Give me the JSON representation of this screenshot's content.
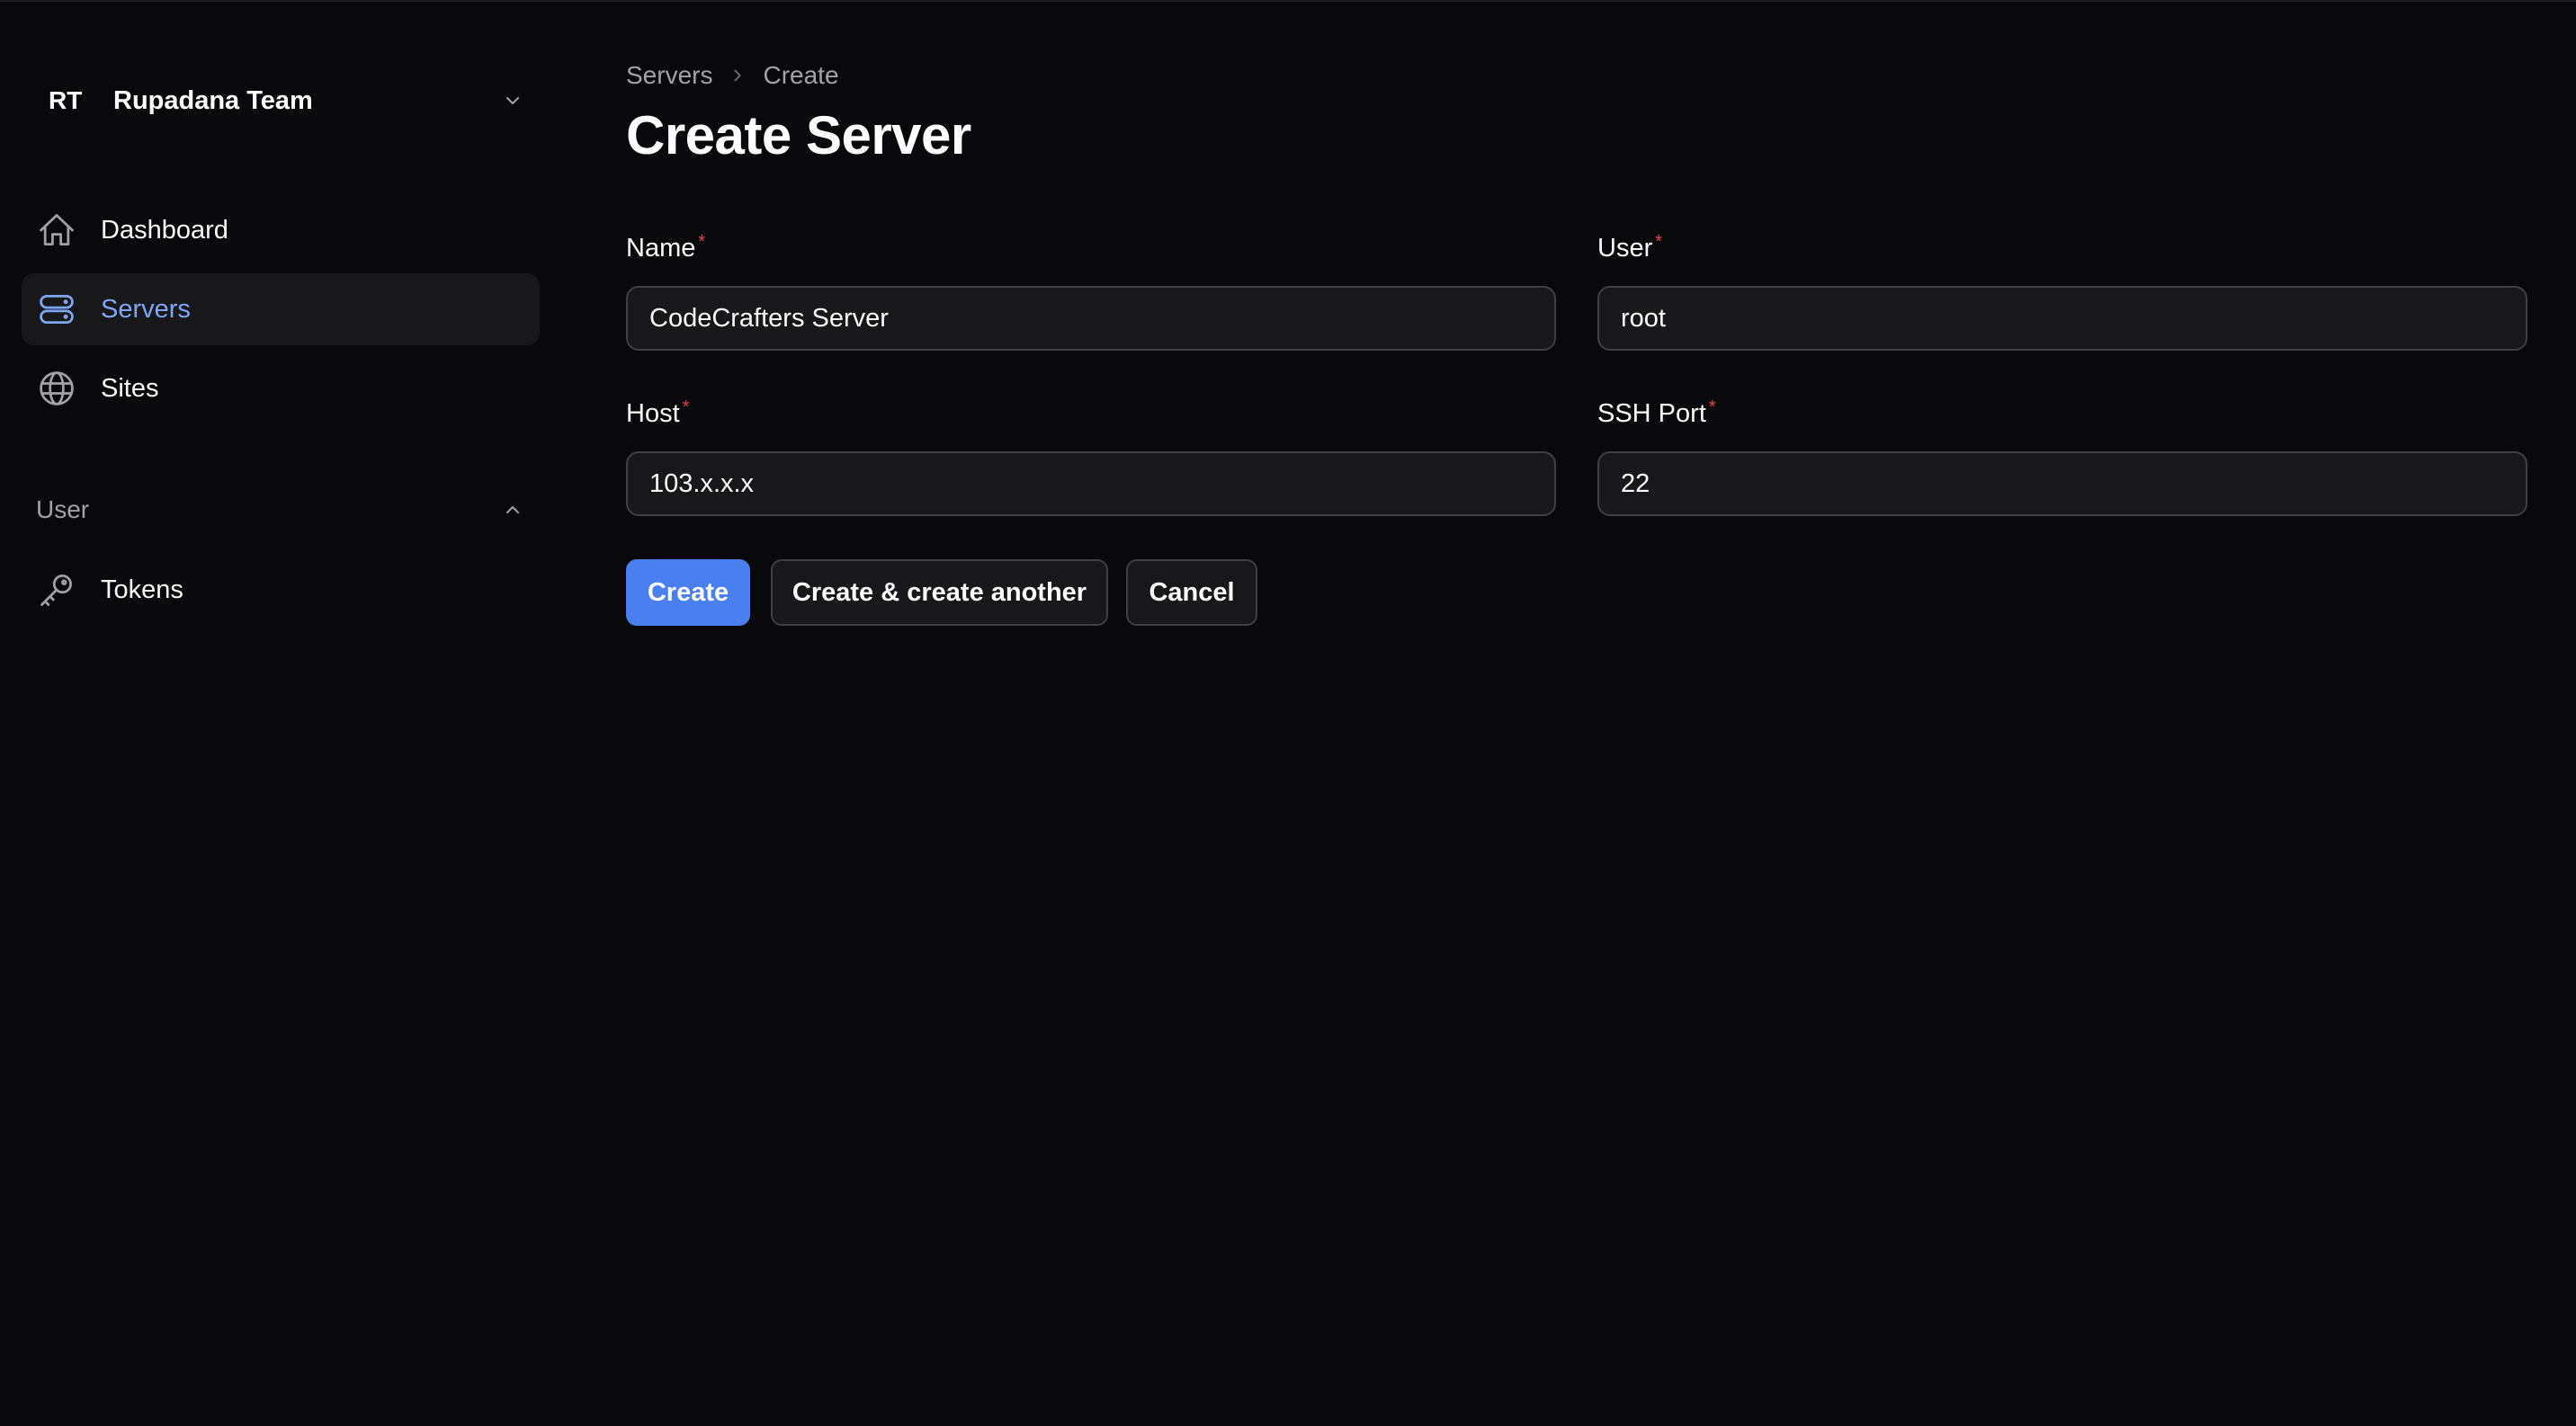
{
  "team": {
    "abbr": "RT",
    "name": "Rupadana Team"
  },
  "nav": {
    "items": [
      {
        "label": "Dashboard",
        "icon": "home-icon",
        "active": false
      },
      {
        "label": "Servers",
        "icon": "server-icon",
        "active": true
      },
      {
        "label": "Sites",
        "icon": "globe-icon",
        "active": false
      }
    ],
    "group": {
      "label": "User",
      "items": [
        {
          "label": "Tokens",
          "icon": "key-icon"
        }
      ]
    }
  },
  "breadcrumb": {
    "items": [
      "Servers",
      "Create"
    ]
  },
  "page": {
    "title": "Create Server"
  },
  "form": {
    "required_mark": "*",
    "name": {
      "label": "Name",
      "value": "CodeCrafters Server"
    },
    "user": {
      "label": "User",
      "value": "root"
    },
    "host": {
      "label": "Host",
      "value": "103.x.x.x"
    },
    "ssh_port": {
      "label": "SSH Port",
      "value": "22"
    }
  },
  "actions": {
    "create": "Create",
    "create_another": "Create & create another",
    "cancel": "Cancel"
  },
  "colors": {
    "accent": "#4a7ff0",
    "active_text": "#7da7f5",
    "required": "#ef4444",
    "background": "#09090b"
  }
}
